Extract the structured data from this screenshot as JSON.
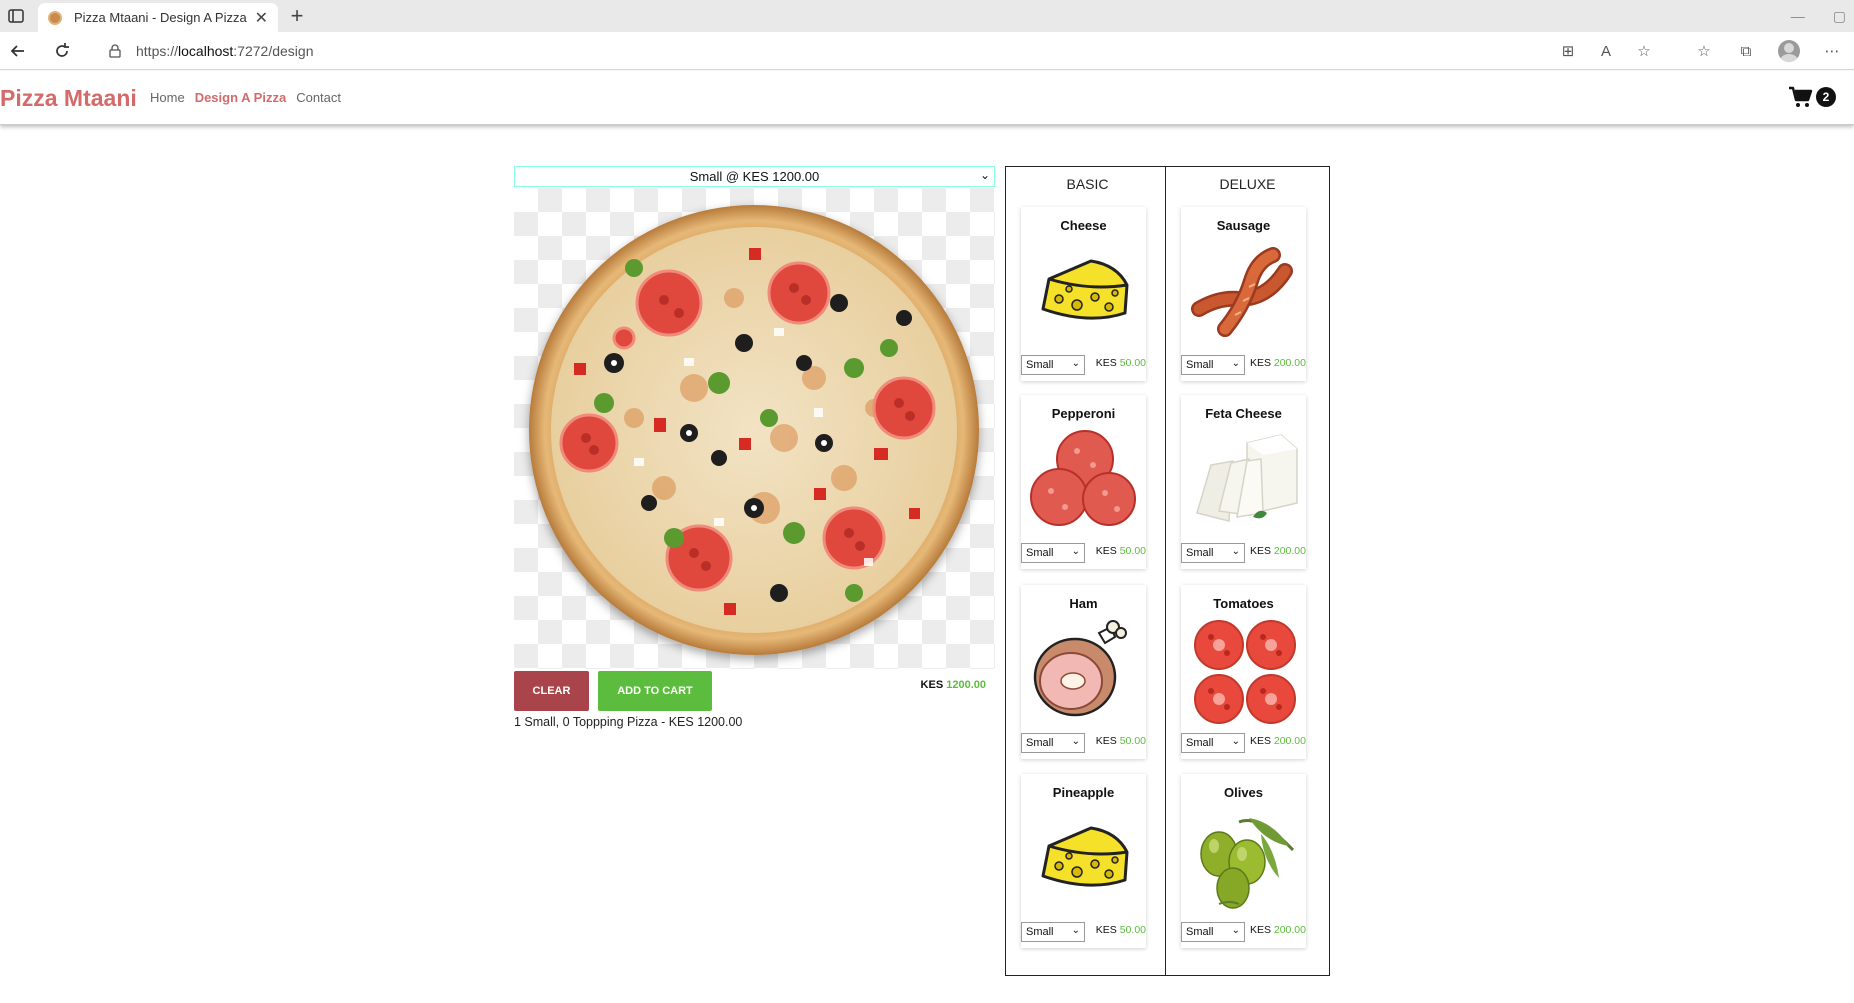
{
  "browser": {
    "tab_title": "Pizza Mtaani - Design A Pizza",
    "url_prefix": "https://",
    "url_host": "localhost",
    "url_rest": ":7272/design",
    "min_glyph": "—",
    "max_glyph": "▢"
  },
  "site": {
    "brand": "Pizza Mtaani",
    "nav": [
      "Home",
      "Design A Pizza",
      "Contact"
    ],
    "active_nav_index": 1,
    "cart_count": "2",
    "accent_color": "#d36b6b"
  },
  "designer": {
    "size_selected": "Small @ KES 1200.00",
    "clear_label": "CLEAR",
    "add_label": "ADD TO CART",
    "total_currency": "KES",
    "total_amount": "1200.00",
    "summary": "1 Small, 0 Toppping Pizza - KES 1200.00"
  },
  "toppings": {
    "basic": {
      "heading": "BASIC",
      "items": [
        {
          "name": "Cheese",
          "size": "Small",
          "currency": "KES",
          "price": "50.00",
          "icon": "cheese-icon"
        },
        {
          "name": "Pepperoni",
          "size": "Small",
          "currency": "KES",
          "price": "50.00",
          "icon": "pepperoni-icon"
        },
        {
          "name": "Ham",
          "size": "Small",
          "currency": "KES",
          "price": "50.00",
          "icon": "ham-icon"
        },
        {
          "name": "Pineapple",
          "size": "Small",
          "currency": "KES",
          "price": "50.00",
          "icon": "cheese-icon"
        }
      ]
    },
    "deluxe": {
      "heading": "DELUXE",
      "items": [
        {
          "name": "Sausage",
          "size": "Small",
          "currency": "KES",
          "price": "200.00",
          "icon": "sausage-icon"
        },
        {
          "name": "Feta Cheese",
          "size": "Small",
          "currency": "KES",
          "price": "200.00",
          "icon": "feta-cheese-icon"
        },
        {
          "name": "Tomatoes",
          "size": "Small",
          "currency": "KES",
          "price": "200.00",
          "icon": "tomatoes-icon"
        },
        {
          "name": "Olives",
          "size": "Small",
          "currency": "KES",
          "price": "200.00",
          "icon": "olives-icon"
        }
      ]
    }
  }
}
